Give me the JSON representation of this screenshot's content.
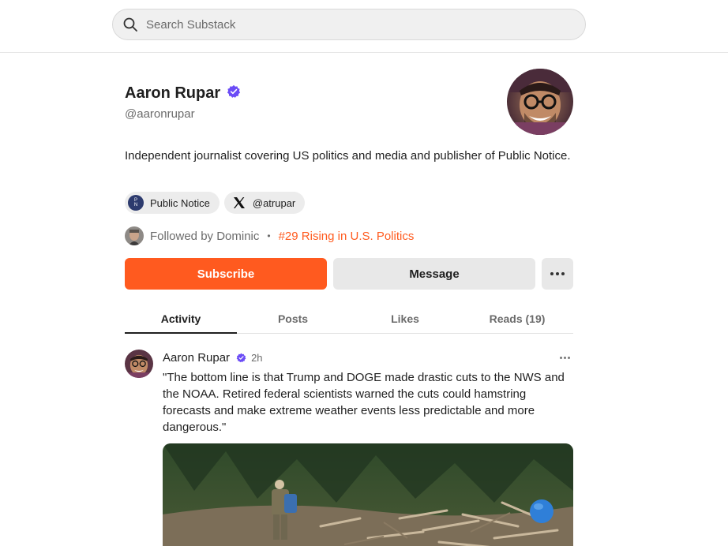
{
  "search": {
    "placeholder": "Search Substack"
  },
  "profile": {
    "name": "Aaron Rupar",
    "handle": "@aaronrupar",
    "bio": "Independent journalist covering US politics and media and publisher of Public Notice."
  },
  "chips": [
    {
      "label": "Public Notice",
      "icon": "public-notice-logo"
    },
    {
      "label": "@atrupar",
      "icon": "x-icon"
    }
  ],
  "followed": {
    "text": "Followed by Dominic",
    "separator": "•",
    "rank": "#29 Rising in U.S. Politics"
  },
  "actions": {
    "subscribe": "Subscribe",
    "message": "Message"
  },
  "tabs": [
    {
      "label": "Activity",
      "active": true
    },
    {
      "label": "Posts"
    },
    {
      "label": "Likes"
    },
    {
      "label": "Reads (19)"
    }
  ],
  "post": {
    "author": "Aaron Rupar",
    "time": "2h",
    "text": "\"The bottom line is that Trump and DOGE made drastic cuts to the NWS and the NOAA. Retired federal scientists warned the cuts could hamstring forecasts and make extreme weather events less predictable and more dangerous.\""
  },
  "colors": {
    "accent": "#ff5a1f",
    "verified": "#6b4cf6",
    "button_secondary": "#e8e8e8"
  }
}
